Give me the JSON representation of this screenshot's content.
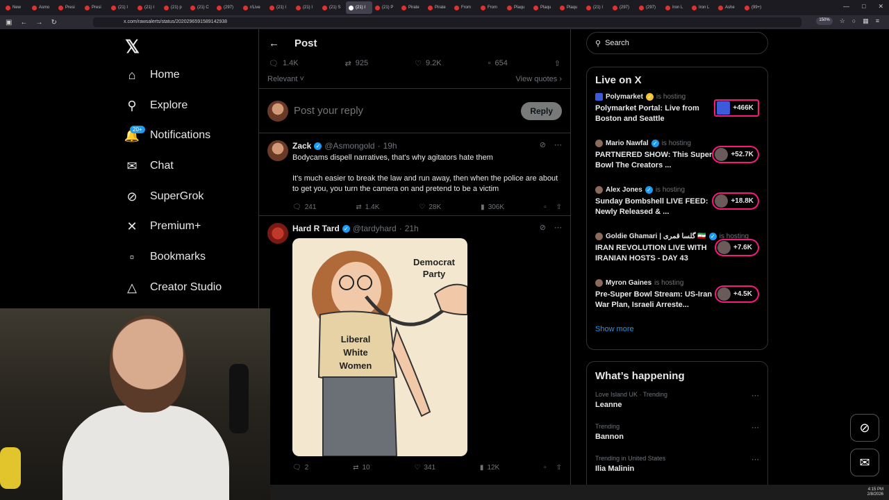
{
  "browser": {
    "tabs": [
      "New",
      "Asmo",
      "Presi",
      "Presi",
      "(21) I",
      "(21) I",
      "(21) p",
      "(21) C",
      "(297)",
      "r/Live",
      "(21) I",
      "(21) I",
      "(21) S",
      "(21) I",
      "(21) P",
      "Pirate",
      "Pirate",
      "From",
      "From",
      "Plaqu",
      "Plaqu",
      "Plaqu",
      "(21) I",
      "(297)",
      "(297)",
      "Iron L",
      "Iron L",
      "Ashe",
      "(99+)"
    ],
    "active_tab": 13,
    "url": "x.com/rawsalerts/status/2020296591589142938",
    "zoom": "150%"
  },
  "nav": {
    "home": "Home",
    "explore": "Explore",
    "notifications": "Notifications",
    "notifications_badge": "20+",
    "chat": "Chat",
    "supergrok": "SuperGrok",
    "premium": "Premium+",
    "bookmarks": "Bookmarks",
    "creator_studio": "Creator Studio"
  },
  "post": {
    "header": "Post",
    "replies": "1.4K",
    "reposts": "925",
    "likes": "9.2K",
    "bookmarks": "654",
    "sort": "Relevant",
    "view_quotes": "View quotes",
    "reply_placeholder": "Post your reply",
    "reply_button": "Reply"
  },
  "tweets": [
    {
      "name": "Zack",
      "handle": "@Asmongold",
      "time": "19h",
      "text1": "Bodycams dispell narratives, that's why agitators hate them",
      "text2": "It's much easier to break the law and run away, then when the police are about to get you, you turn the camera on and pretend to be a victim",
      "replies": "241",
      "reposts": "1.4K",
      "likes": "28K",
      "views": "306K"
    },
    {
      "name": "Hard R Tard",
      "handle": "@tardyhard",
      "time": "21h",
      "meme_label": "Democrat Party",
      "meme_shirt": "Liberal White Women",
      "replies": "2",
      "reposts": "10",
      "likes": "341",
      "views": "12K"
    }
  ],
  "search": {
    "placeholder": "Search"
  },
  "live": {
    "title": "Live on X",
    "hosting_text": "is hosting",
    "items": [
      {
        "host": "Polymarket",
        "title": "Polymarket Portal: Live from Boston and Seattle",
        "count": "+466K"
      },
      {
        "host": "Mario Nawfal",
        "title": "PARTNERED SHOW: This Super Bowl The Creators ...",
        "count": "+52.7K"
      },
      {
        "host": "Alex Jones",
        "title": "Sunday Bombshell LIVE FEED: Newly Released & ...",
        "count": "+18.8K"
      },
      {
        "host": "Goldie Ghamari | گلسا قمری 🇮🇷",
        "title": "IRAN REVOLUTION LIVE WITH IRANIAN HOSTS - DAY 43",
        "count": "+7.6K"
      },
      {
        "host": "Myron Gaines",
        "title": "Pre-Super Bowl Stream: US-Iran War Plan, Israeli Arreste...",
        "count": "+4.5K"
      }
    ],
    "show_more": "Show more"
  },
  "trending": {
    "title": "What’s happening",
    "items": [
      {
        "meta": "Love Island UK · Trending",
        "name": "Leanne"
      },
      {
        "meta": "Trending",
        "name": "Bannon"
      },
      {
        "meta": "Trending in United States",
        "name": "Ilia Malinin"
      }
    ]
  },
  "taskbar": {
    "time": "4:15 PM",
    "date": "2/8/2026"
  },
  "colors": {
    "accent": "#1d9bf0",
    "live_border": "#f91880",
    "background": "#000000"
  }
}
